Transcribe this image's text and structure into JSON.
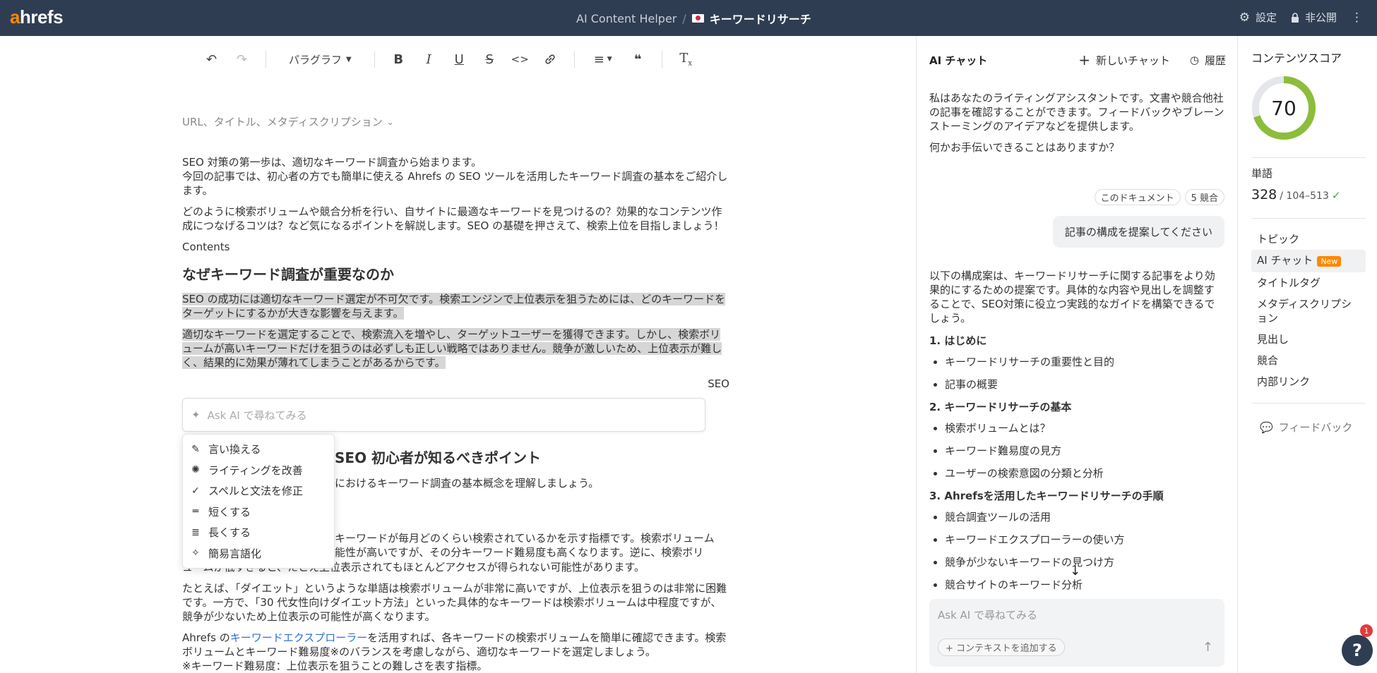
{
  "header": {
    "logo_a": "a",
    "logo_rest": "hrefs",
    "app_name": "AI Content Helper",
    "separator": "/",
    "doc_title": "キーワードリサーチ",
    "settings_label": "設定",
    "privacy_label": "非公開"
  },
  "toolbar": {
    "paragraph_label": "パラグラフ"
  },
  "editor": {
    "meta_toggle": "URL、タイトル、メタディスクリプション",
    "p1a": "SEO 対策の第一歩は、適切なキーワード調査から始まります。",
    "p1b": "今回の記事では、初心者の方でも簡単に使える Ahrefs の SEO ツールを活用したキーワード調査の基本をご紹介します。",
    "p2": "どのように検索ボリュームや競合分析を行い、自サイトに最適なキーワードを見つけるの？効果的なコンテンツ作成につなげるコツは？など気になるポイントを解説します。SEO の基礎を押さえて、検索上位を目指しましょう！",
    "contents": "Contents",
    "h_why": "なぜキーワード調査が重要なのか",
    "p3": "SEO の成功には適切なキーワード選定が不可欠です。検索エンジンで上位表示を狙うためには、どのキーワードをターゲットにするかが大きな影響を与えます。",
    "p4": "適切なキーワードを選定することで、検索流入を増やし、ターゲットユーザーを獲得できます。しかし、検索ボリュームが高いキーワードだけを狙うのは必ずしも正しい戦略ではありません。競争が激しいため、上位表示が難しく、結果的に効果が薄れてしまうことがあるからです。",
    "p5_tail": "SEO",
    "h_basic_tail": "SEO 初心者が知るべきポイント",
    "p6_tail": "におけるキーワード調査の基本概念を理解しましょう。",
    "p7a_tail": "キーワードが毎月どのくらい検索されているかを示す指標です。検索ボリューム",
    "p7b_tail": "能性が高いですが、その分キーワード難易度も高くなります。逆に、検索ボリ",
    "p7c": "ュームが低すぎると、たとえ上位表示されてもほとんどアクセスが得られない可能性があります。",
    "p8": "たとえば、「ダイエット」というような単語は検索ボリュームが非常に高いですが、上位表示を狙うのは非常に困難です。一方で、「30 代女性向けダイエット方法」といった具体的なキーワードは検索ボリュームは中程度ですが、競争が少ないため上位表示の可能性が高くなります。",
    "p9_pre": "Ahrefs の",
    "p9_link": "キーワードエクスプローラー",
    "p9_post": "を活用すれば、各キーワードの検索ボリュームを簡単に確認できます。検索ボリュームとキーワード難易度※のバランスを考慮しながら、適切なキーワードを選定しましょう。",
    "p10": "※キーワード難易度：上位表示を狙うことの難しさを表す指標。"
  },
  "ask_ai": {
    "placeholder": "Ask AI で尋ねてみる"
  },
  "ai_menu": {
    "items": [
      {
        "label": "言い換える",
        "icon": "pencil-icon"
      },
      {
        "label": "ライティングを改善",
        "icon": "sparkle-icon"
      },
      {
        "label": "スペルと文法を修正",
        "icon": "check-icon"
      },
      {
        "label": "短くする",
        "icon": "short-lines-icon"
      },
      {
        "label": "長くする",
        "icon": "long-lines-icon"
      },
      {
        "label": "簡易言語化",
        "icon": "magic-icon"
      }
    ]
  },
  "chat": {
    "title": "AI チャット",
    "new_chat": "新しいチャット",
    "history": "履歴",
    "intro": "私はあなたのライティングアシスタントです。文書や競合他社の記事を確認することができます。フィードバックやブレーンストーミングのアイデアなどを提供します。",
    "question": "何かお手伝いできることはありますか？",
    "chip_doc": "このドキュメント",
    "chip_comp": "5 競合",
    "user_msg": "記事の構成を提案してください",
    "reply_intro": "以下の構成案は、キーワードリサーチに関する記事をより効果的にするための提案です。具体的な内容や見出しを調整することで、SEO対策に役立つ実践的なガイドを構築できるでしょう。",
    "sections": [
      {
        "title": "1. はじめに",
        "items": [
          "キーワードリサーチの重要性と目的",
          "記事の概要"
        ]
      },
      {
        "title": "2. キーワードリサーチの基本",
        "items": [
          "検索ボリュームとは？",
          "キーワード難易度の見方",
          "ユーザーの検索意図の分類と分析"
        ]
      },
      {
        "title": "3. Ahrefsを活用したキーワードリサーチの手順",
        "items": [
          "競合調査ツールの活用",
          "キーワードエクスプローラーの使い方",
          "競争が少ないキーワードの見つけ方",
          "競合サイトのキーワード分析"
        ]
      }
    ],
    "composer_placeholder": "Ask AI で尋ねてみる",
    "add_context": "+ コンテキストを追加する"
  },
  "score": {
    "title": "コンテンツスコア",
    "value": "70",
    "fraction": 0.7,
    "gauge_color": "#8dbd3a",
    "words_label": "単語",
    "word_count": "328",
    "word_range": "/ 104–513",
    "nav": [
      {
        "label": "トピック"
      },
      {
        "label": "AI チャット",
        "badge": "New",
        "active": true
      },
      {
        "label": "タイトルタグ"
      },
      {
        "label": "メタディスクリプション"
      },
      {
        "label": "見出し"
      },
      {
        "label": "競合"
      },
      {
        "label": "内部リンク"
      }
    ],
    "feedback": "フィードバック"
  },
  "help": {
    "label": "?",
    "badge": "1"
  }
}
